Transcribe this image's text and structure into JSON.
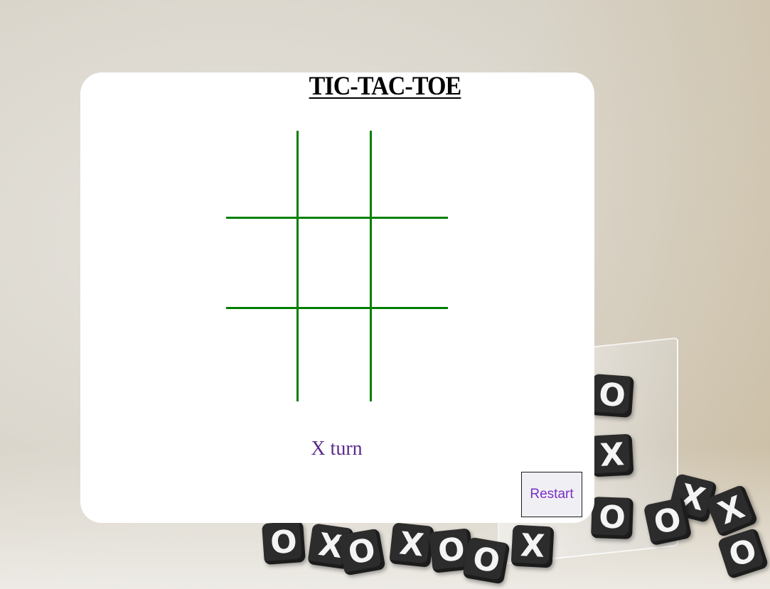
{
  "game": {
    "title": "TIC-TAC-TOE",
    "status": "X turn",
    "restart_label": "Restart",
    "board": [
      "",
      "",
      "",
      "",
      "",
      "",
      "",
      "",
      ""
    ],
    "grid_color": "#008000",
    "status_color": "#5b2c8c",
    "accent_color": "#7a2fc9"
  },
  "background": {
    "dice_marks": [
      "O",
      "X",
      "O",
      "X",
      "O",
      "X",
      "O",
      "X",
      "O",
      "X",
      "O",
      "X",
      "O",
      "O"
    ]
  }
}
